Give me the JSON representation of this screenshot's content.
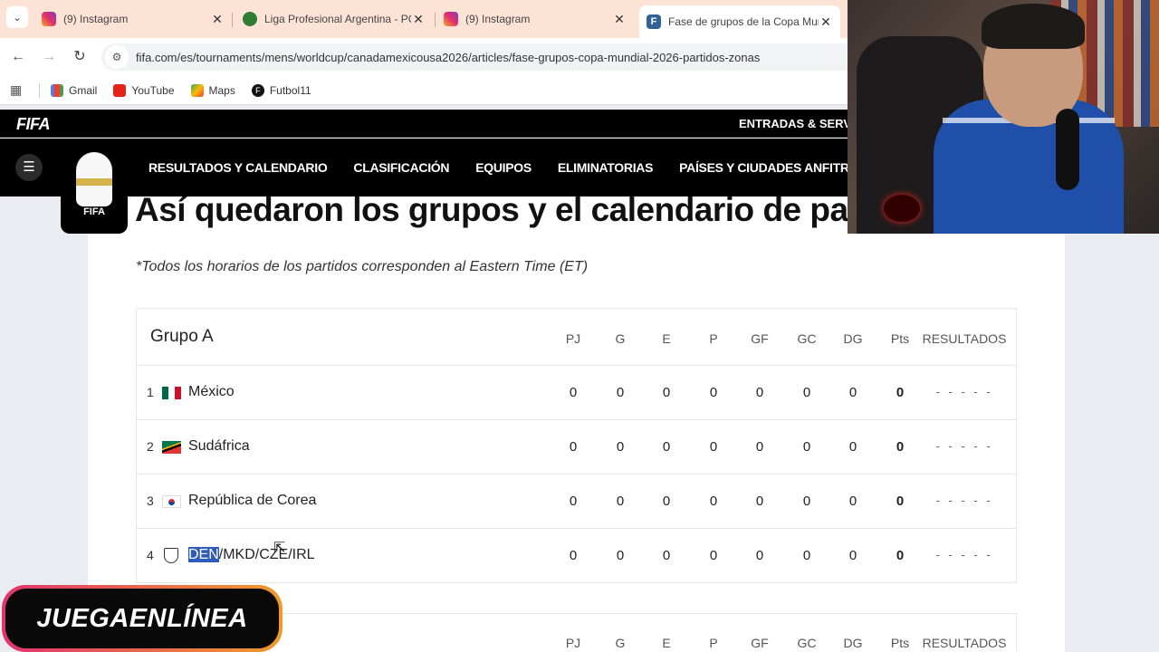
{
  "browser": {
    "tabs": [
      {
        "title": "(9) Instagram",
        "favicon": "instagram-icon"
      },
      {
        "title": "Liga Profesional Argentina - PO",
        "favicon": "liga-icon"
      },
      {
        "title": "(9) Instagram",
        "favicon": "instagram-icon"
      },
      {
        "title": "Fase de grupos de la Copa Mun",
        "favicon": "fifa-icon",
        "active": true
      }
    ],
    "url": "fifa.com/es/tournaments/mens/worldcup/canadamexicousa2026/articles/fase-grupos-copa-mundial-2026-partidos-zonas",
    "bookmarks": [
      "Gmail",
      "YouTube",
      "Maps",
      "Futbol11"
    ],
    "tab_menu_glyph": "⌄",
    "close_glyph": "✕"
  },
  "fifa": {
    "logo": "FIFA",
    "tickets_label": "ENTRADAS & SERVICIO",
    "nav": [
      "RESULTADOS Y CALENDARIO",
      "CLASIFICACIÓN",
      "EQUIPOS",
      "ELIMINATORIAS",
      "PAÍSES Y CIUDADES ANFITRIONAS"
    ],
    "badge_wordmark": "FIFA"
  },
  "article": {
    "headline": "Así quedaron los grupos y el calendario de pa",
    "note": "*Todos los horarios de los partidos corresponden al Eastern Time (ET)"
  },
  "table": {
    "columns": [
      "PJ",
      "G",
      "E",
      "P",
      "GF",
      "GC",
      "DG",
      "Pts",
      "RESULTADOS"
    ],
    "group_title": "Grupo A",
    "rows": [
      {
        "pos": "1",
        "team": "México",
        "flag": "mexico-flag",
        "stats": [
          "0",
          "0",
          "0",
          "0",
          "0",
          "0",
          "0",
          "0"
        ],
        "results": "- - - - -"
      },
      {
        "pos": "2",
        "team": "Sudáfrica",
        "flag": "south-africa-flag",
        "stats": [
          "0",
          "0",
          "0",
          "0",
          "0",
          "0",
          "0",
          "0"
        ],
        "results": "- - - - -"
      },
      {
        "pos": "3",
        "team": "República de Corea",
        "flag": "korea-flag",
        "stats": [
          "0",
          "0",
          "0",
          "0",
          "0",
          "0",
          "0",
          "0"
        ],
        "results": "- - - - -"
      },
      {
        "pos": "4",
        "team_highlight": "DEN",
        "team_rest": "/MKD/CZE/IRL",
        "flag": "shield-icon",
        "stats": [
          "0",
          "0",
          "0",
          "0",
          "0",
          "0",
          "0",
          "0"
        ],
        "results": "- - - - -"
      }
    ]
  },
  "overlay": {
    "brand": "JUEGAENLÍNEA"
  },
  "colors": {
    "tabstrip": "#fde3d6",
    "fifa_header": "#000000",
    "selection": "#2f5cb8"
  }
}
